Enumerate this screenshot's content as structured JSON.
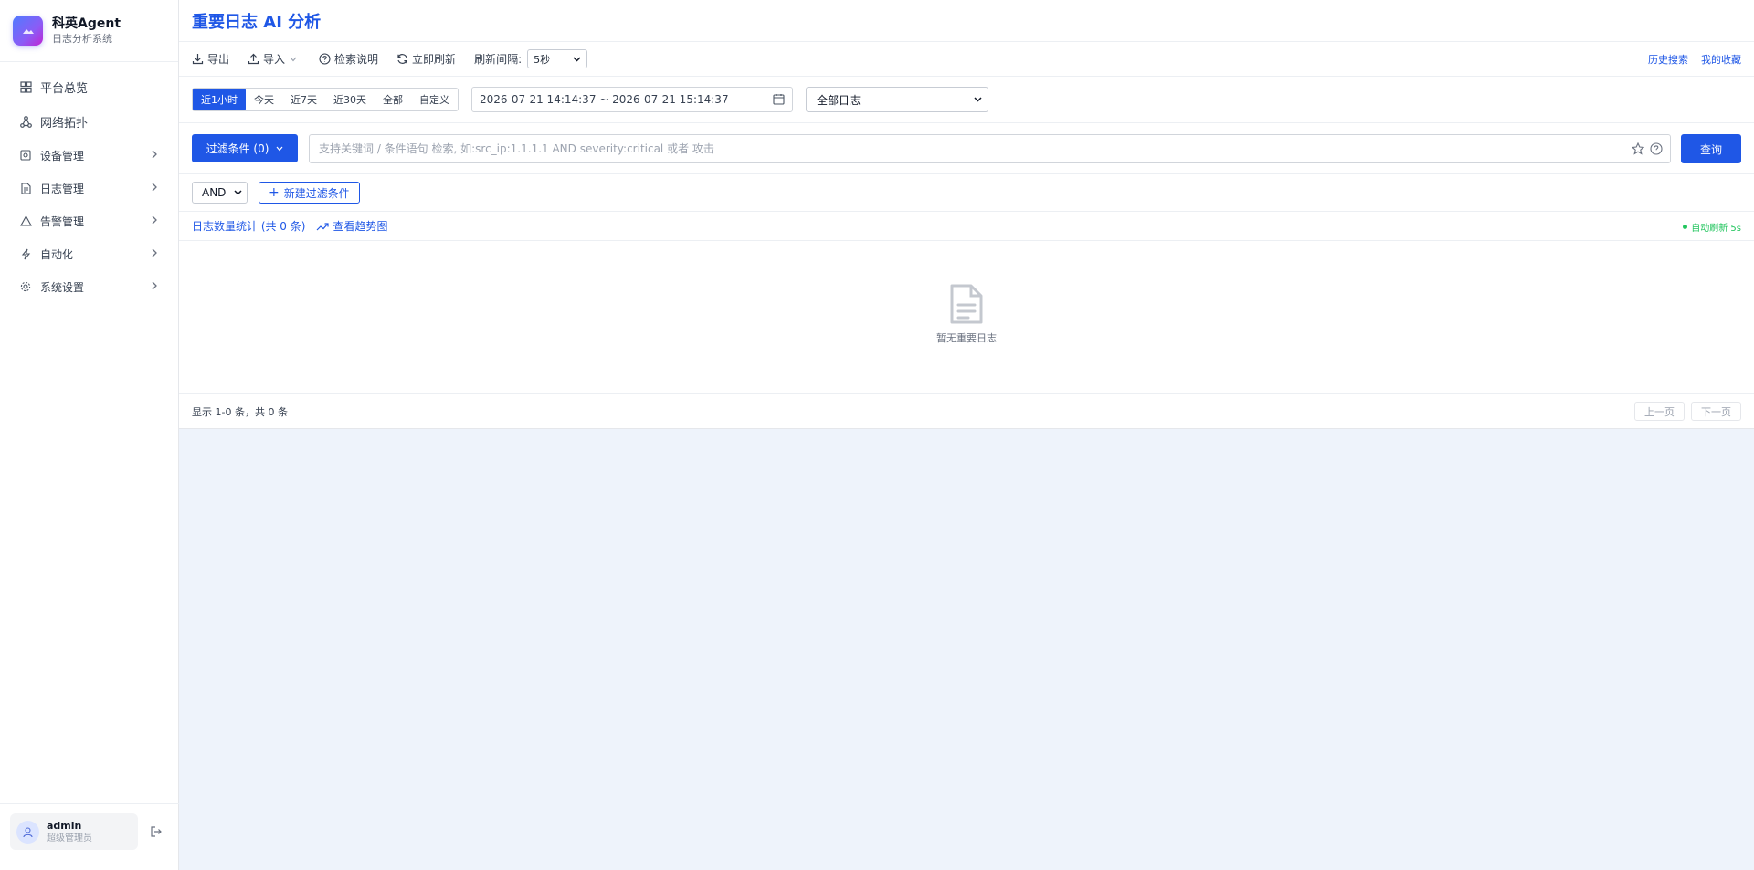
{
  "brand": {
    "title": "科英Agent",
    "subtitle": "日志分析系统"
  },
  "sidebar": {
    "items": [
      {
        "label": "平台总览",
        "icon": "dashboard-icon",
        "has_children": false
      },
      {
        "label": "网络拓扑",
        "icon": "topology-icon",
        "has_children": false
      },
      {
        "label": "设备管理",
        "icon": "device-icon",
        "has_children": true
      },
      {
        "label": "日志管理",
        "icon": "document-icon",
        "has_children": true
      },
      {
        "label": "告警管理",
        "icon": "alert-icon",
        "has_children": true
      },
      {
        "label": "自动化",
        "icon": "lightning-icon",
        "has_children": true
      },
      {
        "label": "系统设置",
        "icon": "gear-icon",
        "has_children": true
      }
    ]
  },
  "user": {
    "name": "admin",
    "role": "超级管理员"
  },
  "page": {
    "title": "重要日志 AI 分析"
  },
  "toolbar": {
    "export_label": "导出",
    "import_label": "导入",
    "help_label": "检索说明",
    "refresh_label": "立即刷新",
    "interval_label": "刷新间隔:",
    "interval_value": "5秒",
    "history_label": "历史搜索",
    "favorites_label": "我的收藏"
  },
  "time_ranges": [
    {
      "label": "近1小时",
      "active": true
    },
    {
      "label": "今天",
      "active": false
    },
    {
      "label": "近7天",
      "active": false
    },
    {
      "label": "近30天",
      "active": false
    },
    {
      "label": "全部",
      "active": false
    },
    {
      "label": "自定义",
      "active": false
    }
  ],
  "date_range": {
    "value": "2026-07-21 14:14:37 ~ 2026-07-21 15:14:37"
  },
  "log_type": {
    "value": "全部日志"
  },
  "search": {
    "filter_label": "过滤条件 (0)",
    "placeholder": "支持关键词 / 条件语句 检索, 如:src_ip:1.1.1.1 AND severity:critical 或者 攻击",
    "query_label": "查询"
  },
  "conditions": {
    "logic_value": "AND",
    "new_label": "新建过滤条件"
  },
  "stats": {
    "summary": "日志数量统计 (共 0 条)",
    "trend_label": "查看趋势图",
    "auto_refresh": "自动刷新 5s"
  },
  "empty": {
    "message": "暂无重要日志"
  },
  "pager": {
    "info": "显示 1-0 条，共 0 条",
    "prev_label": "上一页",
    "next_label": "下一页"
  },
  "colors": {
    "accent": "#1f57e6",
    "success": "#22c55e",
    "background": "#eef3fb"
  }
}
